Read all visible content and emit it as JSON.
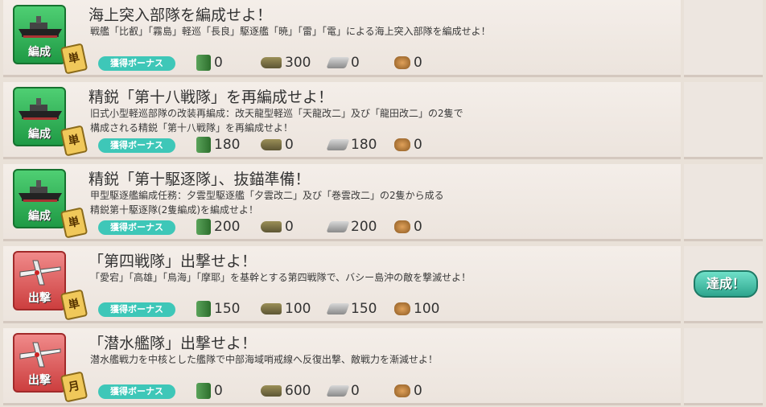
{
  "quests": [
    {
      "category": "編成",
      "frequency": "単",
      "title": "海上突入部隊を編成せよ！",
      "desc": [
        "戦艦「比叡」「霧島」軽巡「長良」駆逐艦「暁」「雷」「電」による海上突入部隊を編成せよ！"
      ],
      "bonus": "獲得ボーナス",
      "fuel": "0",
      "ammo": "300",
      "steel": "0",
      "baux": "0"
    },
    {
      "category": "編成",
      "frequency": "単",
      "title": "精鋭「第十八戦隊」を再編成せよ！",
      "desc": [
        "旧式小型軽巡部隊の改装再編成：改天龍型軽巡「天龍改二」及び「龍田改二」の2隻で",
        "構成される精鋭「第十八戦隊」を再編成せよ！"
      ],
      "bonus": "獲得ボーナス",
      "fuel": "180",
      "ammo": "0",
      "steel": "180",
      "baux": "0"
    },
    {
      "category": "編成",
      "frequency": "単",
      "title": "精鋭「第十駆逐隊」、抜錨準備！",
      "desc": [
        "甲型駆逐艦編成任務：夕雲型駆逐艦「夕雲改二」及び「巻雲改二」の2隻から成る",
        "精鋭第十駆逐隊(2隻編成)を編成せよ！"
      ],
      "bonus": "獲得ボーナス",
      "fuel": "200",
      "ammo": "0",
      "steel": "200",
      "baux": "0"
    },
    {
      "category": "出撃",
      "frequency": "単",
      "title": "「第四戦隊」出撃せよ！",
      "desc": [
        "「愛宕」「高雄」「鳥海」「摩耶」を基幹とする第四戦隊で、バシー島沖の敵を撃滅せよ！"
      ],
      "bonus": "獲得ボーナス",
      "fuel": "150",
      "ammo": "100",
      "steel": "150",
      "baux": "100"
    },
    {
      "category": "出撃",
      "frequency": "月",
      "title": "「潜水艦隊」出撃せよ！",
      "desc": [
        "潜水艦戦力を中核とした艦隊で中部海域哨戒線へ反復出撃、敵戦力を漸減せよ！"
      ],
      "bonus": "獲得ボーナス",
      "fuel": "0",
      "ammo": "600",
      "steel": "0",
      "baux": "0"
    }
  ],
  "achieved_label": "達成！",
  "colors": {
    "organize": "#2fa84f",
    "sortie": "#d04545",
    "bonus": "#3ec7b8"
  },
  "icons": {
    "fuel": "fuel-icon",
    "ammo": "ammo-icon",
    "steel": "steel-icon",
    "baux": "bauxite-icon"
  }
}
